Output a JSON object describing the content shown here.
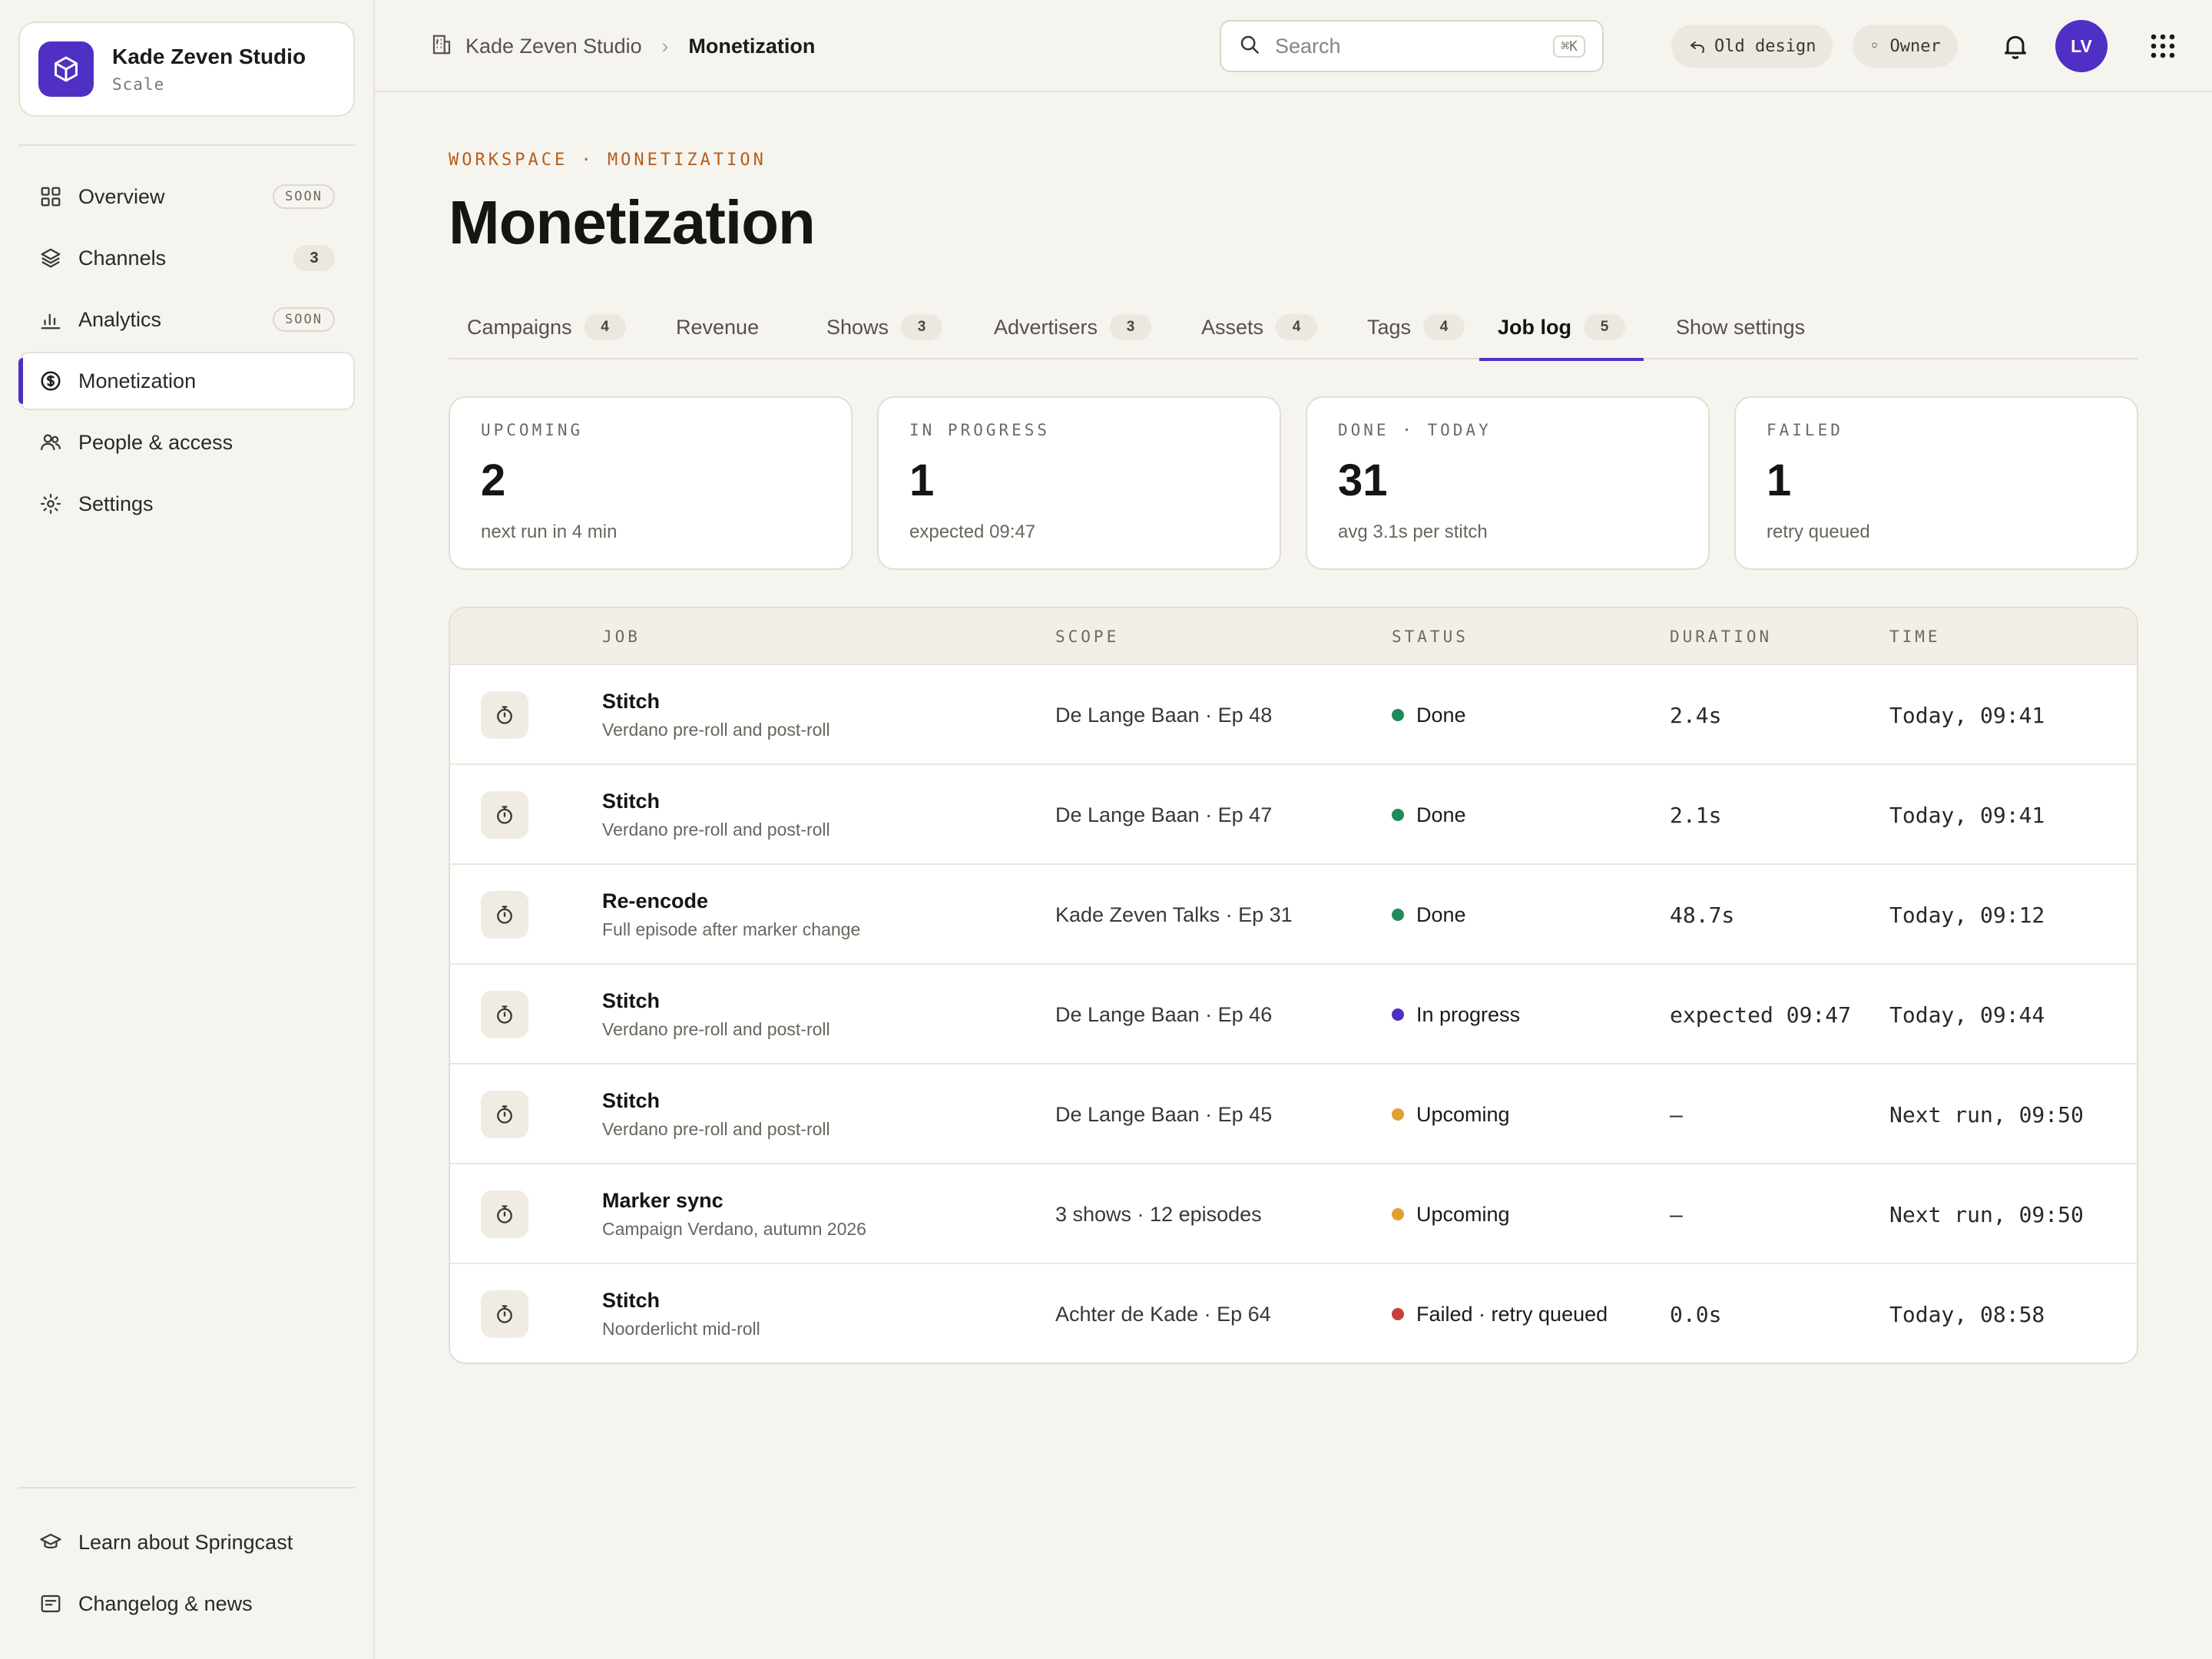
{
  "workspace": {
    "name": "Kade Zeven Studio",
    "plan": "Scale"
  },
  "nav": {
    "items": [
      {
        "label": "Overview",
        "badge": "SOON",
        "icon": "grid-icon"
      },
      {
        "label": "Channels",
        "badge": "3",
        "icon": "layers-icon"
      },
      {
        "label": "Analytics",
        "badge": "SOON",
        "icon": "bar-chart-icon"
      },
      {
        "label": "Monetization",
        "badge": "",
        "icon": "coin-icon"
      },
      {
        "label": "People & access",
        "badge": "",
        "icon": "users-icon"
      },
      {
        "label": "Settings",
        "badge": "",
        "icon": "gear-icon"
      }
    ],
    "active": "Monetization",
    "footer": [
      {
        "label": "Learn about Springcast",
        "icon": "graduation-cap-icon"
      },
      {
        "label": "Changelog & news",
        "icon": "news-icon"
      }
    ]
  },
  "topbar": {
    "breadcrumb": [
      "Kade Zeven Studio",
      "Monetization"
    ],
    "search_placeholder": "Search",
    "search_shortcut": "⌘K",
    "old_design": "Old design",
    "role": "◦ Owner",
    "avatar_initials": "LV"
  },
  "page": {
    "eyebrow": "WORKSPACE · MONETIZATION",
    "title": "Monetization"
  },
  "tabs": [
    {
      "label": "Campaigns",
      "count": "4"
    },
    {
      "label": "Revenue",
      "count": ""
    },
    {
      "label": "Shows",
      "count": "3"
    },
    {
      "label": "Advertisers",
      "count": "3"
    },
    {
      "label": "Assets",
      "count": "4"
    },
    {
      "label": "Tags",
      "count": "4"
    },
    {
      "label": "Job log",
      "count": "5"
    },
    {
      "label": "Show settings",
      "count": ""
    }
  ],
  "active_tab": "Job log",
  "stats": [
    {
      "label": "UPCOMING",
      "value": "2",
      "sub": "next run in 4 min"
    },
    {
      "label": "IN PROGRESS",
      "value": "1",
      "sub": "expected 09:47"
    },
    {
      "label": "DONE · TODAY",
      "value": "31",
      "sub": "avg 3.1s per stitch"
    },
    {
      "label": "FAILED",
      "value": "1",
      "sub": "retry queued"
    }
  ],
  "table": {
    "columns": [
      "JOB",
      "SCOPE",
      "STATUS",
      "DURATION",
      "TIME"
    ],
    "rows": [
      {
        "job": "Stitch",
        "desc": "Verdano pre-roll and post-roll",
        "scope": "De Lange Baan · Ep 48",
        "status": "Done",
        "status_color": "#1f8a5b",
        "duration": "2.4s",
        "time": "Today, 09:41"
      },
      {
        "job": "Stitch",
        "desc": "Verdano pre-roll and post-roll",
        "scope": "De Lange Baan · Ep 47",
        "status": "Done",
        "status_color": "#1f8a5b",
        "duration": "2.1s",
        "time": "Today, 09:41"
      },
      {
        "job": "Re-encode",
        "desc": "Full episode after marker change",
        "scope": "Kade Zeven Talks · Ep 31",
        "status": "Done",
        "status_color": "#1f8a5b",
        "duration": "48.7s",
        "time": "Today, 09:12"
      },
      {
        "job": "Stitch",
        "desc": "Verdano pre-roll and post-roll",
        "scope": "De Lange Baan · Ep 46",
        "status": "In progress",
        "status_color": "#4f2fc4",
        "duration": "expected 09:47",
        "time": "Today, 09:44"
      },
      {
        "job": "Stitch",
        "desc": "Verdano pre-roll and post-roll",
        "scope": "De Lange Baan · Ep 45",
        "status": "Upcoming",
        "status_color": "#e0a030",
        "duration": "—",
        "time": "Next run, 09:50"
      },
      {
        "job": "Marker sync",
        "desc": "Campaign Verdano, autumn 2026",
        "scope": "3 shows · 12 episodes",
        "status": "Upcoming",
        "status_color": "#e0a030",
        "duration": "—",
        "time": "Next run, 09:50"
      },
      {
        "job": "Stitch",
        "desc": "Noorderlicht mid-roll",
        "scope": "Achter de Kade · Ep 64",
        "status": "Failed · retry queued",
        "status_color": "#c8403a",
        "duration": "0.0s",
        "time": "Today, 08:58"
      }
    ]
  },
  "colors": {
    "accent": "#4f2fc4",
    "eyebrow": "#b65e1e",
    "background": "#f6f4ee"
  }
}
